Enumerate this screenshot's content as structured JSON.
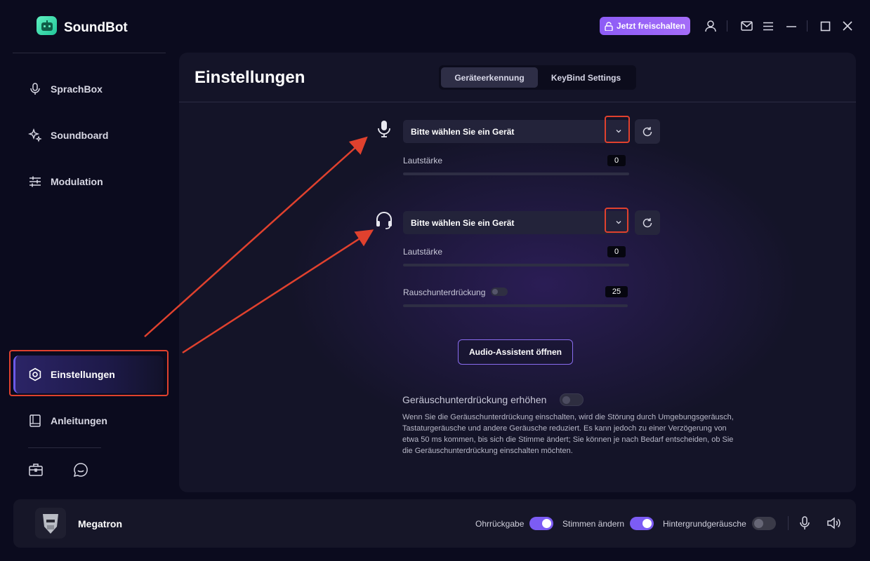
{
  "app": {
    "name": "SoundBot",
    "unlock_label": "Jetzt freischalten"
  },
  "sidebar": {
    "items": [
      {
        "label": "SprachBox",
        "icon": "microphone-icon"
      },
      {
        "label": "Soundboard",
        "icon": "sparkle-icon"
      },
      {
        "label": "Modulation",
        "icon": "sliders-icon"
      },
      {
        "label": "Einstellungen",
        "icon": "settings-hexagon-icon",
        "active": true
      },
      {
        "label": "Anleitungen",
        "icon": "book-icon"
      }
    ],
    "footer_icons": [
      "toolbox-icon",
      "chat-icon"
    ]
  },
  "main": {
    "title": "Einstellungen",
    "tabs": [
      {
        "label": "Geräteerkennung",
        "active": true
      },
      {
        "label": "KeyBind Settings",
        "active": false
      }
    ],
    "input_device": {
      "placeholder": "Bitte wählen Sie ein Gerät",
      "volume_label": "Lautstärke",
      "volume_value": "0"
    },
    "output_device": {
      "placeholder": "Bitte wählen Sie ein Gerät",
      "volume_label": "Lautstärke",
      "volume_value": "0",
      "noise_label": "Rauschunterdrückung",
      "noise_value": "25"
    },
    "assistant_button": "Audio-Assistent öffnen",
    "noise_boost": {
      "title": "Geräuschunterdrückung erhöhen",
      "enabled": false,
      "description": "Wenn Sie die Geräuschunterdrückung einschalten, wird die Störung durch Umgebungsgeräusch, Tastaturgeräusche und andere Geräusche reduziert. Es kann jedoch zu einer Verzögerung von etwa 50 ms kommen, bis sich die Stimme ändert; Sie können je nach Bedarf entscheiden, ob Sie die Geräuschunterdrückung einschalten möchten."
    }
  },
  "bottom_bar": {
    "voice_name": "Megatron",
    "toggles": [
      {
        "label": "Ohrrückgabe",
        "enabled": true
      },
      {
        "label": "Stimmen ändern",
        "enabled": true
      },
      {
        "label": "Hintergrundgeräusche",
        "enabled": false
      }
    ]
  },
  "colors": {
    "accent": "#7c5cf4",
    "highlight_box": "#e0412e",
    "background": "#0b0b1e",
    "panel": "#141428"
  }
}
